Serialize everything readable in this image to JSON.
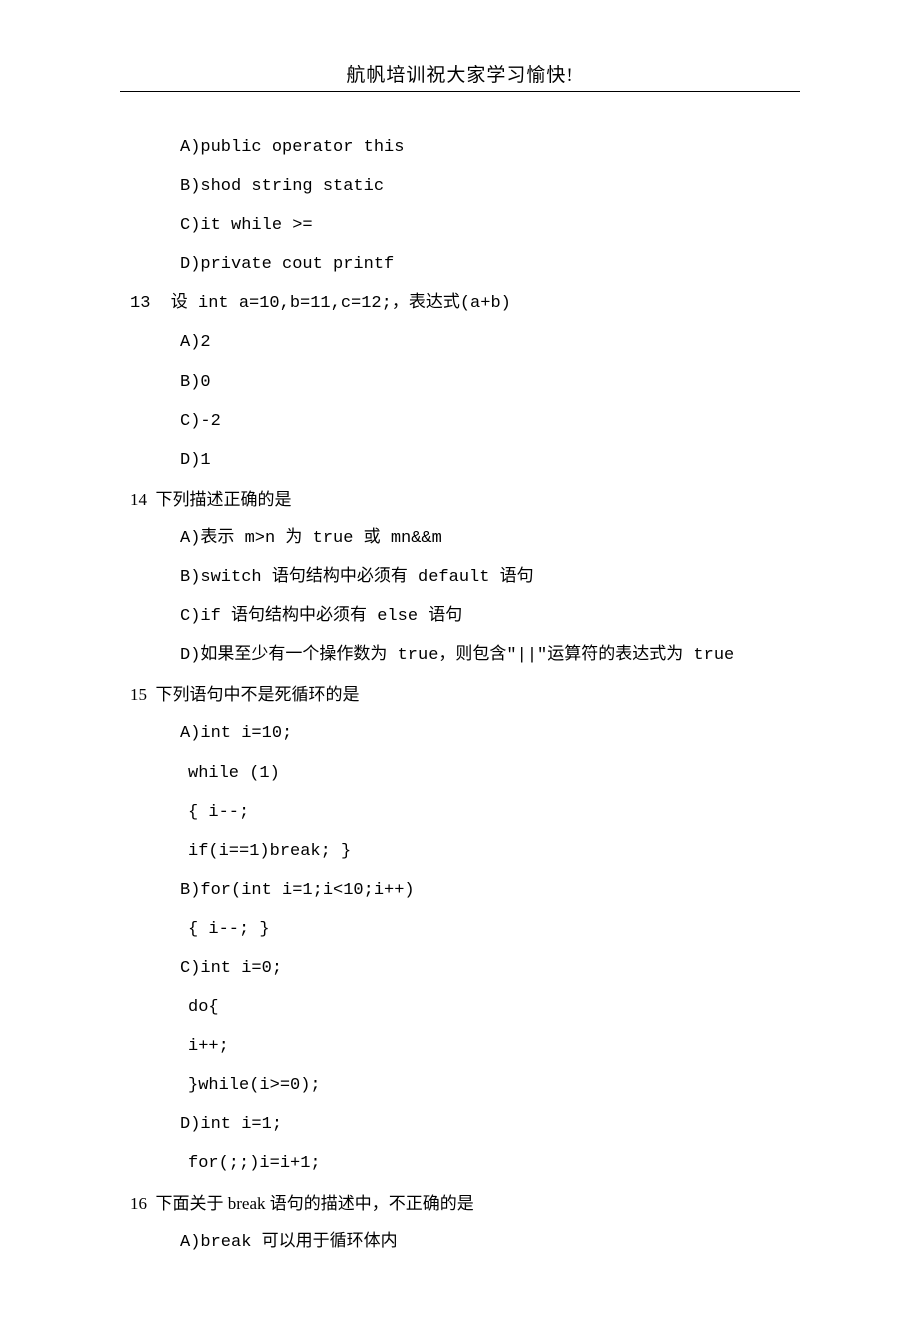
{
  "header": {
    "title": "航帆培训祝大家学习愉快!"
  },
  "lines": {
    "l1": "A)public operator this",
    "l2": "B)shod string static",
    "l3": "C)it while >=",
    "l4": "D)private cout printf",
    "q13": "13  设 int a=10,b=11,c=12;，表达式(a+b)",
    "q13a": "A)2",
    "q13b": "B)0",
    "q13c": "C)-2",
    "q13d": "D)1",
    "q14": "14  下列描述正确的是",
    "q14a": "A)表示 m>n 为 true 或 mn&&m",
    "q14b": "B)switch 语句结构中必须有 default 语句",
    "q14c": "C)if 语句结构中必须有 else 语句",
    "q14d": "D)如果至少有一个操作数为 true，则包含\"||\"运算符的表达式为 true",
    "q15": "15  下列语句中不是死循环的是",
    "q15a": "A)int i=10;",
    "q15a2": "while (1)",
    "q15a3": "{ i--;",
    "q15a4": "if(i==1)break; }",
    "q15b": "B)for(int i=1;i<10;i++)",
    "q15b2": "{ i--; }",
    "q15c": "C)int i=0;",
    "q15c2": "do{",
    "q15c3": "i++;",
    "q15c4": "}while(i>=0);",
    "q15d": "D)int i=1;",
    "q15d2": "for(;;)i=i+1;",
    "q16": "16  下面关于 break 语句的描述中，不正确的是",
    "q16a": "A)break 可以用于循环体内"
  }
}
